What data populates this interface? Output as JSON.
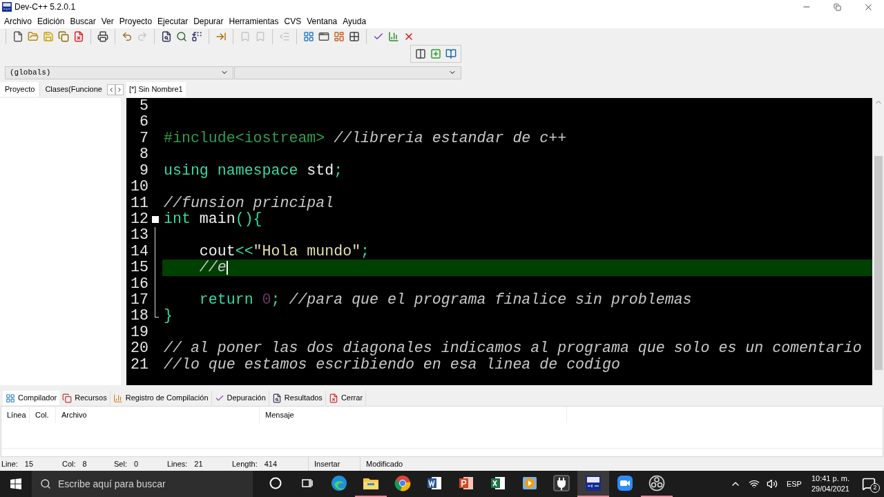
{
  "window": {
    "title": "Dev-C++ 5.2.0.1"
  },
  "menu": [
    "Archivo",
    "Edición",
    "Buscar",
    "Ver",
    "Proyecto",
    "Ejecutar",
    "Depurar",
    "Herramientas",
    "CVS",
    "Ventana",
    "Ayuda"
  ],
  "toolbar": [
    [
      {
        "kind": "new",
        "disabled": false
      },
      {
        "kind": "open",
        "disabled": false
      },
      {
        "kind": "save",
        "disabled": false
      },
      {
        "kind": "save-all",
        "disabled": false
      },
      {
        "kind": "close",
        "disabled": false
      }
    ],
    [
      {
        "kind": "print",
        "disabled": false
      }
    ],
    [
      {
        "kind": "undo",
        "disabled": false
      },
      {
        "kind": "redo",
        "disabled": true
      }
    ],
    [
      {
        "kind": "find",
        "disabled": false
      },
      {
        "kind": "find-next",
        "disabled": false
      },
      {
        "kind": "replace",
        "disabled": false
      }
    ],
    [
      {
        "kind": "goto",
        "disabled": false
      }
    ],
    [
      {
        "kind": "bookmark",
        "disabled": true
      },
      {
        "kind": "bookmark",
        "disabled": true
      }
    ],
    [
      {
        "kind": "unindent",
        "disabled": true
      }
    ],
    [
      {
        "kind": "compile",
        "disabled": false
      },
      {
        "kind": "run",
        "disabled": false
      },
      {
        "kind": "compile-run",
        "disabled": false
      },
      {
        "kind": "rebuild",
        "disabled": false
      }
    ],
    [
      {
        "kind": "check",
        "disabled": false
      },
      {
        "kind": "chart",
        "disabled": false
      },
      {
        "kind": "delete",
        "disabled": false
      }
    ]
  ],
  "toolbar_2": [
    {
      "kind": "class-browser",
      "disabled": false
    },
    {
      "kind": "add",
      "disabled": false
    },
    {
      "kind": "book",
      "disabled": false
    }
  ],
  "combos": [
    {
      "value": "(globals)"
    }
  ],
  "side_tabs": [
    {
      "label": "Proyecto",
      "selected": true
    },
    {
      "label": "Clases(Funcione",
      "selected": false
    }
  ],
  "editor_tabs": [
    {
      "label": "[*] Sin Nombre1",
      "selected": true
    }
  ],
  "code": [
    {
      "number": "5",
      "kind": "plain",
      "current": false
    },
    {
      "number": "6",
      "kind": "plain",
      "current": false
    },
    {
      "number": "7",
      "kind": "plain",
      "current": false,
      "tokens": [
        {
          "kind": "pre",
          "text": "#include<iostream>"
        },
        {
          "kind": "com",
          "text": " //libreria estandar de c++"
        }
      ]
    },
    {
      "number": "8",
      "kind": "plain",
      "current": false
    },
    {
      "number": "9",
      "kind": "plain",
      "current": false,
      "tokens": [
        {
          "kind": "kw",
          "text": "using namespace"
        },
        {
          "kind": "id",
          "text": " std"
        },
        {
          "kind": "sym",
          "text": ";"
        }
      ]
    },
    {
      "number": "10",
      "kind": "plain",
      "current": false
    },
    {
      "number": "11",
      "kind": "plain",
      "current": false,
      "tokens": [
        {
          "kind": "com",
          "text": "//funsion principal"
        }
      ]
    },
    {
      "number": "12",
      "kind": "fold-start",
      "current": false,
      "tokens": [
        {
          "kind": "kw",
          "text": "int"
        },
        {
          "kind": "id",
          "text": " main"
        },
        {
          "kind": "sym",
          "text": "(){"
        }
      ]
    },
    {
      "number": "13",
      "kind": "fold-body",
      "current": false
    },
    {
      "number": "14",
      "kind": "fold-body",
      "current": false,
      "tokens": [
        {
          "kind": "id",
          "text": "    cout"
        },
        {
          "kind": "sym",
          "text": "<<"
        },
        {
          "kind": "str",
          "text": "\"Hola mundo\""
        },
        {
          "kind": "sym",
          "text": ";"
        }
      ]
    },
    {
      "number": "15",
      "kind": "fold-body",
      "current": true,
      "tokens": [
        {
          "kind": "com",
          "text": "    //e"
        }
      ]
    },
    {
      "number": "16",
      "kind": "fold-body",
      "current": false
    },
    {
      "number": "17",
      "kind": "fold-body",
      "current": false,
      "tokens": [
        {
          "kind": "kw",
          "text": "    return"
        },
        {
          "kind": "num",
          "text": " 0"
        },
        {
          "kind": "sym",
          "text": ";"
        },
        {
          "kind": "com",
          "text": " //para que el programa finalice sin problemas"
        }
      ]
    },
    {
      "number": "18",
      "kind": "fold-end",
      "current": false,
      "tokens": [
        {
          "kind": "sym",
          "text": "}"
        }
      ]
    },
    {
      "number": "19",
      "kind": "plain",
      "current": false
    },
    {
      "number": "20",
      "kind": "plain",
      "current": false,
      "tokens": [
        {
          "kind": "com",
          "text": "// al poner las dos diagonales indicamos al programa que solo es un comentario"
        }
      ]
    },
    {
      "number": "21",
      "kind": "plain",
      "current": false,
      "tokens": [
        {
          "kind": "com",
          "text": "//lo que estamos escribiendo en esa linea de codigo"
        }
      ]
    }
  ],
  "bottom_tabs": [
    {
      "kind": "compiler",
      "label": "Compilador",
      "selected": true
    },
    {
      "kind": "resources",
      "label": "Recursos",
      "selected": false
    },
    {
      "kind": "log",
      "label": "Registro de Compilación",
      "selected": false
    },
    {
      "kind": "debug",
      "label": "Depuración",
      "selected": false
    },
    {
      "kind": "results",
      "label": "Resultados",
      "selected": false
    },
    {
      "kind": "close",
      "label": "Cerrar",
      "selected": false
    }
  ],
  "table": {
    "columns": [
      "Línea",
      "Col.",
      "Archivo",
      "Mensaje"
    ]
  },
  "status_bar": [
    {
      "label": "Line:",
      "value": "15"
    },
    {
      "label": "Col:",
      "value": "8"
    },
    {
      "label": "Sel:",
      "value": "0"
    },
    {
      "label": "Lines:",
      "value": "21"
    },
    {
      "label": "Length:",
      "value": "414"
    },
    {
      "label": "Insertar"
    },
    {
      "label": "Modificado"
    }
  ],
  "taskbar": {
    "search": {
      "placeholder": "Escribe aquí para buscar"
    },
    "apps": [
      {
        "kind": "cortana",
        "running": false,
        "selected": false
      },
      {
        "kind": "task-view",
        "running": false,
        "selected": false
      },
      {
        "kind": "edge",
        "running": false,
        "selected": false
      },
      {
        "kind": "files",
        "running": true,
        "selected": false
      },
      {
        "kind": "chrome",
        "running": false,
        "selected": false
      },
      {
        "kind": "word",
        "running": false,
        "selected": false
      },
      {
        "kind": "powerpoint",
        "running": false,
        "selected": false
      },
      {
        "kind": "excel",
        "running": false,
        "selected": false
      },
      {
        "kind": "player",
        "running": false,
        "selected": false
      },
      {
        "kind": "plug",
        "running": false,
        "selected": false
      },
      {
        "kind": "dev",
        "running": true,
        "selected": true
      },
      {
        "kind": "zoom",
        "running": false,
        "selected": false
      },
      {
        "kind": "obs",
        "running": true,
        "selected": false
      }
    ],
    "language": "ESP",
    "time": "10:41 p. m.",
    "date": "29/04/2021",
    "notifications": "2"
  }
}
